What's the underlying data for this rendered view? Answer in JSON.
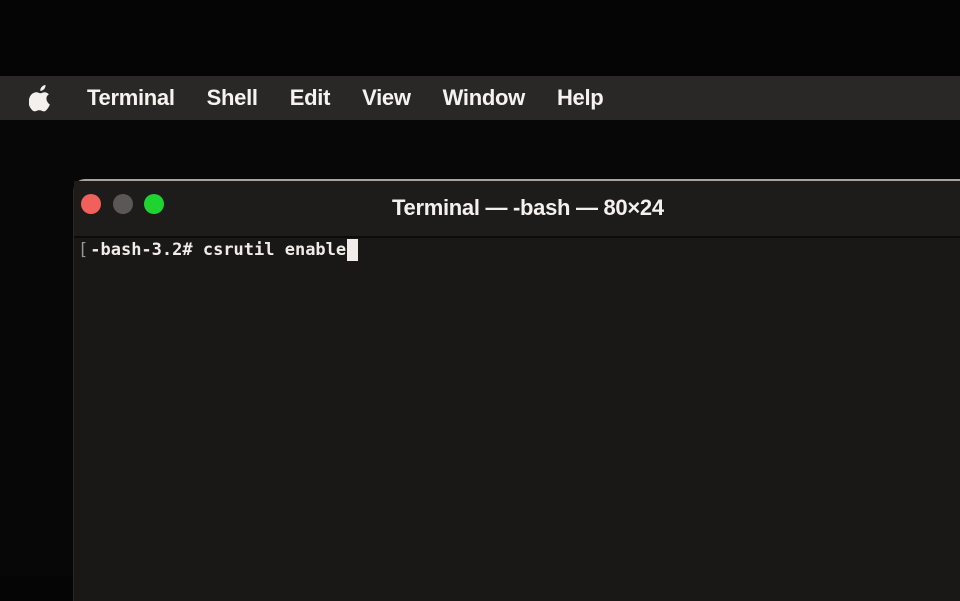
{
  "menubar": {
    "apple_icon": "apple-logo",
    "items": [
      {
        "label": "Terminal"
      },
      {
        "label": "Shell"
      },
      {
        "label": "Edit"
      },
      {
        "label": "View"
      },
      {
        "label": "Window"
      },
      {
        "label": "Help"
      }
    ]
  },
  "window": {
    "title": "Terminal — -bash — 80×24",
    "traffic_lights": {
      "close": {
        "color": "#f2605c"
      },
      "minimize": {
        "color": "#5b5756"
      },
      "zoom": {
        "color": "#1ed42f"
      }
    },
    "terminal": {
      "line_marker": "[",
      "prompt": "-bash-3.2#",
      "command": " csrutil enable"
    }
  }
}
